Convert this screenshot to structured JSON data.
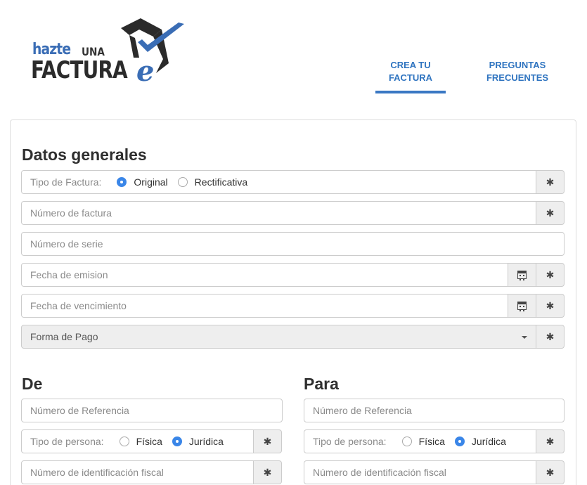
{
  "brand": {
    "logo_hazte": "hazte",
    "logo_una": "UNA",
    "logo_factura": "FACTURA",
    "logo_e": "e",
    "colors": {
      "accent": "#3a6db5",
      "nav": "#2f74c0",
      "dark": "#2b2b2b"
    }
  },
  "nav": {
    "items": [
      {
        "line1": "CREA TU",
        "line2": "FACTURA",
        "active": true
      },
      {
        "line1": "PREGUNTAS",
        "line2": "FRECUENTES",
        "active": false
      }
    ]
  },
  "general": {
    "title": "Datos generales",
    "tipo_label": "Tipo de Factura:",
    "tipo_options": [
      "Original",
      "Rectificativa"
    ],
    "tipo_selected": "Original",
    "numero_factura": "Número de factura",
    "numero_serie": "Número de serie",
    "fecha_emision": "Fecha de emision",
    "fecha_vencimiento": "Fecha de vencimiento",
    "forma_pago": "Forma de Pago",
    "required_icon": "asterisk-icon",
    "calendar_icon": "calendar-icon"
  },
  "de": {
    "title": "De",
    "referencia": "Número de Referencia",
    "persona_label": "Tipo de persona:",
    "persona_options": [
      "Física",
      "Jurídica"
    ],
    "persona_selected": "Jurídica",
    "nif": "Número de identificación fiscal"
  },
  "para": {
    "title": "Para",
    "referencia": "Número de Referencia",
    "persona_label": "Tipo de persona:",
    "persona_options": [
      "Física",
      "Jurídica"
    ],
    "persona_selected": "Jurídica",
    "nif": "Número de identificación fiscal"
  }
}
